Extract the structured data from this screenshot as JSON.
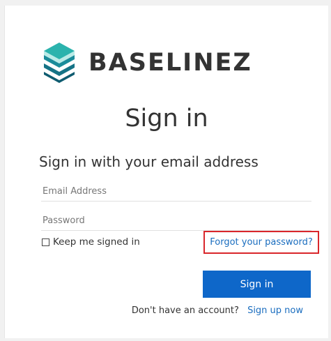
{
  "brand": {
    "name": "BASELINEZ",
    "logo_icon": "stacked-layers-icon",
    "logo_colors": [
      "#1aa3a3",
      "#177a8c",
      "#3fc3b8"
    ]
  },
  "page": {
    "heading": "Sign in",
    "subheading": "Sign in with your email address"
  },
  "form": {
    "email_placeholder": "Email Address",
    "password_placeholder": "Password",
    "keep_signed_in_label": "Keep me signed in",
    "keep_signed_in_checked": false,
    "forgot_password_label": "Forgot your password?",
    "signin_button_label": "Sign in"
  },
  "signup": {
    "prompt": "Don't have an account?",
    "link_label": "Sign up now"
  },
  "colors": {
    "primary_button": "#0e67c9",
    "link": "#1a6dbf",
    "highlight_border": "#d9262b"
  }
}
